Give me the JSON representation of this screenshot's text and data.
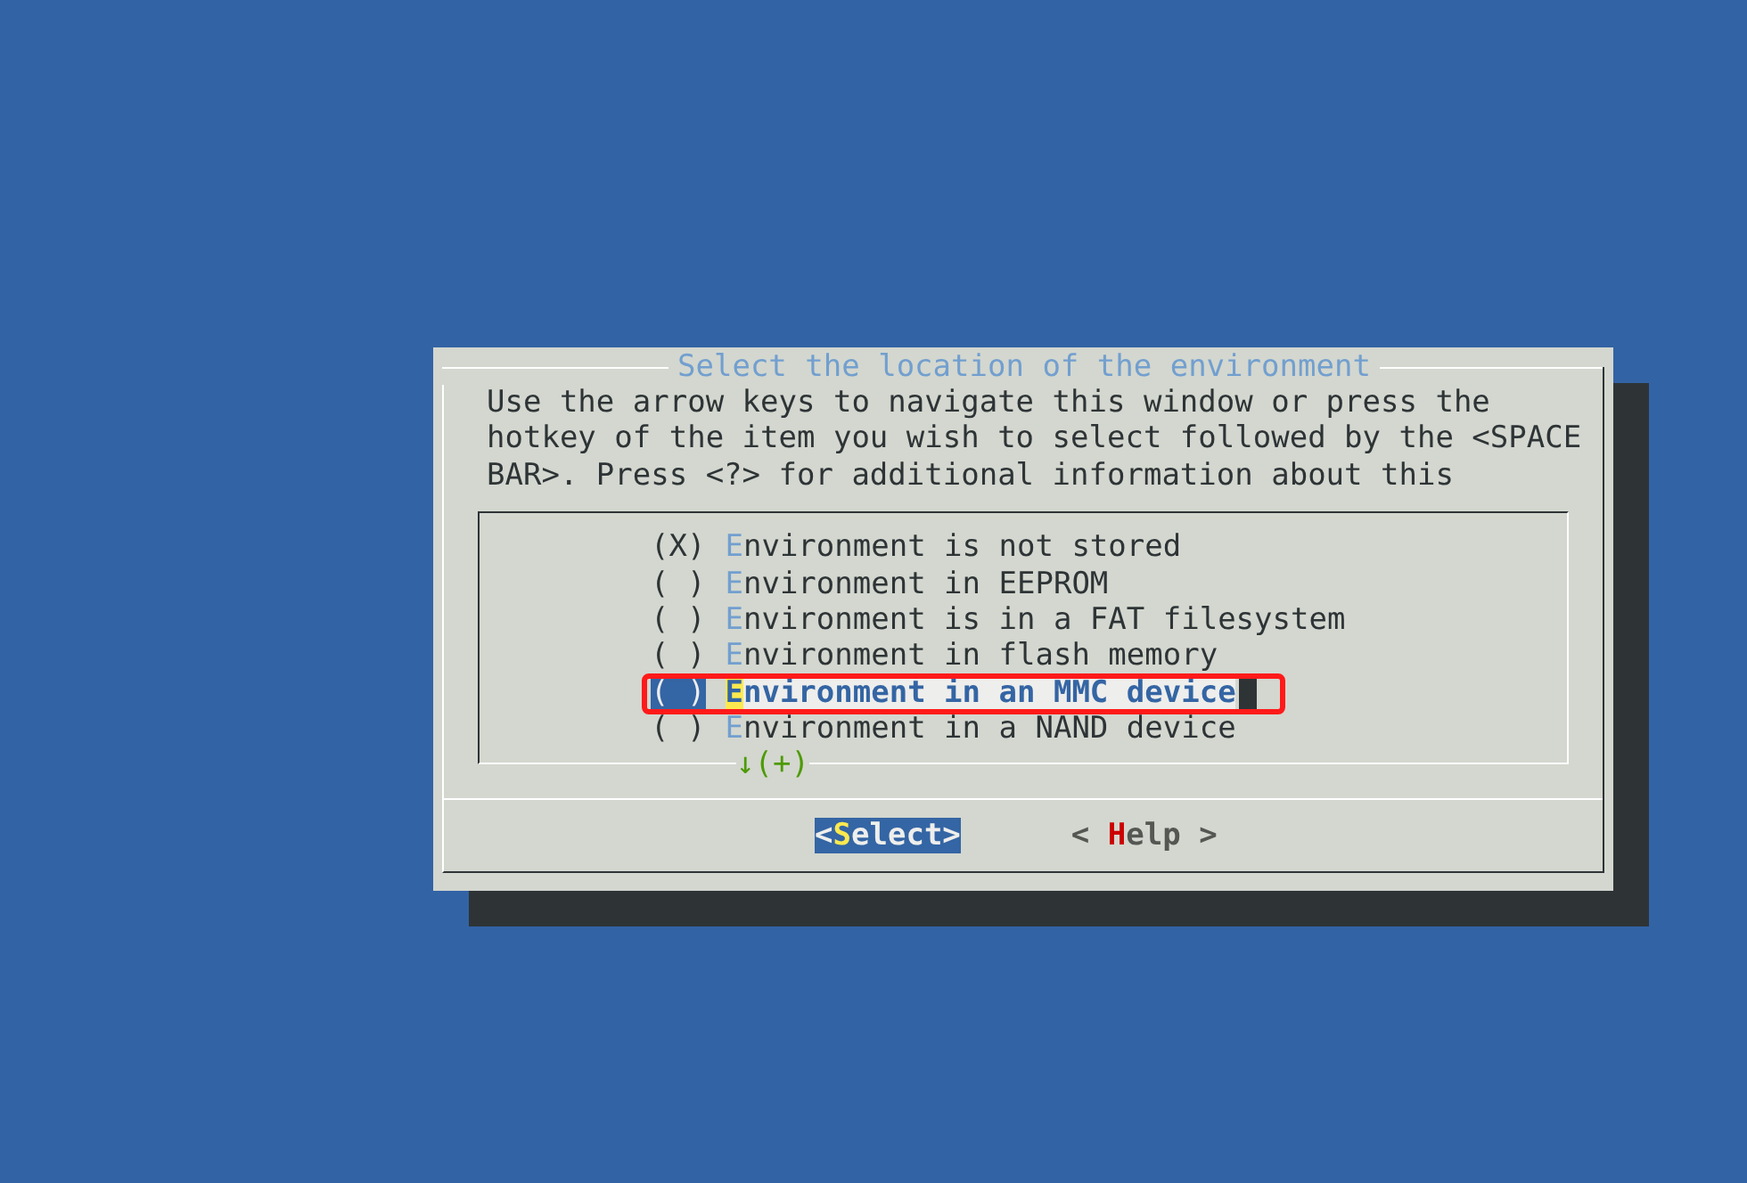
{
  "dialog": {
    "title": "Select the location of the environment",
    "help_lines": [
      "Use the arrow keys to navigate this window or press the",
      "hotkey of the item you wish to select followed by the <SPACE",
      "BAR>. Press <?> for additional information about this"
    ],
    "options": [
      {
        "marker": "(X)",
        "label": "Environment is not stored",
        "selected": false,
        "annotated": false
      },
      {
        "marker": "( )",
        "label": "Environment in EEPROM",
        "selected": false,
        "annotated": false
      },
      {
        "marker": "( )",
        "label": "Environment is in a FAT filesystem",
        "selected": false,
        "annotated": false
      },
      {
        "marker": "( )",
        "label": "Environment in flash memory",
        "selected": false,
        "annotated": false
      },
      {
        "marker": "( )",
        "label": "Environment in an MMC device",
        "selected": true,
        "annotated": true
      },
      {
        "marker": "( )",
        "label": "Environment in a NAND device",
        "selected": false,
        "annotated": false
      }
    ],
    "scroll_indicator": "↓(+)",
    "buttons": [
      {
        "label": "<Select>",
        "selected": true
      },
      {
        "label": "< Help >",
        "selected": false
      }
    ]
  }
}
